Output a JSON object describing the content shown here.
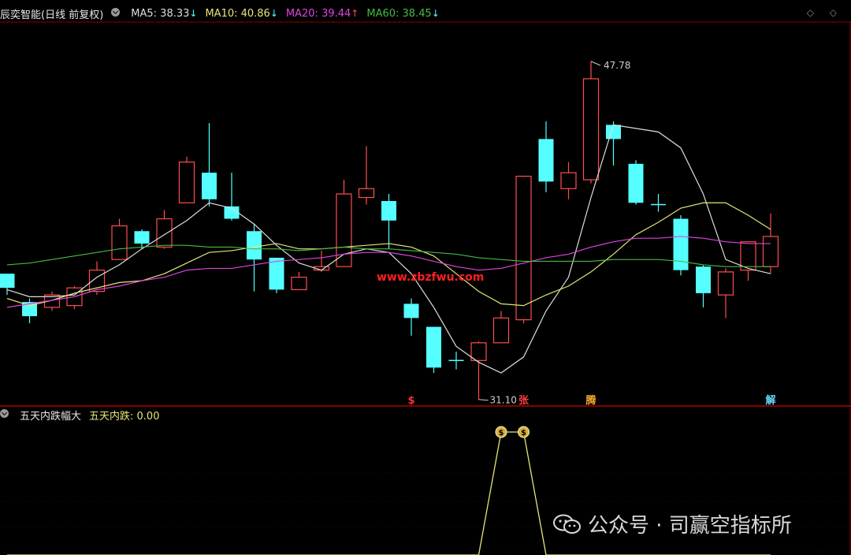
{
  "header": {
    "title": "辰奕智能(日线 前复权)",
    "ma5_label": "MA5: 38.33",
    "ma5_arrow": "↓",
    "ma10_label": "MA10: 40.86",
    "ma10_arrow": "↓",
    "ma20_label": "MA20: 39.44",
    "ma20_arrow": "↑",
    "ma60_label": "MA60: 38.45",
    "ma60_arrow": "↓",
    "top_icons": "◇ ◇"
  },
  "sub_header": {
    "title": "五天内跌幅大",
    "value_label": "五天内跌: 0.00"
  },
  "watermark": "www.zbzfwu.com",
  "credit": "公众号 · 司赢空指标所",
  "colors": {
    "up": "#ff4d4d",
    "down": "#55ffff",
    "ma5": "#dddddd",
    "ma10": "#e6e678",
    "ma20": "#dd44dd",
    "ma60": "#44bb44",
    "sub_line": "#e6e678"
  },
  "chart_data": {
    "type": "candlestick",
    "ylim": [
      29,
      50
    ],
    "annotations": {
      "high": "47.78",
      "low": "31.10"
    },
    "candles": [
      {
        "o": 35.8,
        "c": 35.0,
        "h": 35.8,
        "l": 34.6
      },
      {
        "o": 34.2,
        "c": 33.4,
        "h": 34.4,
        "l": 33.0
      },
      {
        "o": 33.9,
        "c": 34.6,
        "h": 34.8,
        "l": 33.7
      },
      {
        "o": 34.0,
        "c": 35.0,
        "h": 35.1,
        "l": 33.8
      },
      {
        "o": 34.8,
        "c": 36.0,
        "h": 36.5,
        "l": 34.6
      },
      {
        "o": 36.6,
        "c": 38.5,
        "h": 38.9,
        "l": 36.6
      },
      {
        "o": 38.2,
        "c": 37.5,
        "h": 38.3,
        "l": 37.2
      },
      {
        "o": 37.3,
        "c": 38.9,
        "h": 39.4,
        "l": 37.2
      },
      {
        "o": 39.8,
        "c": 42.1,
        "h": 42.4,
        "l": 39.8
      },
      {
        "o": 41.5,
        "c": 40.0,
        "h": 44.3,
        "l": 39.6
      },
      {
        "o": 39.6,
        "c": 38.9,
        "h": 41.5,
        "l": 38.8
      },
      {
        "o": 38.2,
        "c": 36.6,
        "h": 38.6,
        "l": 34.8
      },
      {
        "o": 36.7,
        "c": 34.9,
        "h": 36.7,
        "l": 34.7
      },
      {
        "o": 34.9,
        "c": 35.6,
        "h": 35.9,
        "l": 34.9
      },
      {
        "o": 36.0,
        "c": 36.2,
        "h": 37.1,
        "l": 35.9
      },
      {
        "o": 36.2,
        "c": 40.3,
        "h": 41.1,
        "l": 36.2
      },
      {
        "o": 40.1,
        "c": 40.6,
        "h": 43.0,
        "l": 39.7
      },
      {
        "o": 39.9,
        "c": 38.8,
        "h": 40.3,
        "l": 37.2
      },
      {
        "o": 34.1,
        "c": 33.3,
        "h": 34.4,
        "l": 32.3
      },
      {
        "o": 32.8,
        "c": 30.5,
        "h": 32.8,
        "l": 30.2
      },
      {
        "o": 30.9,
        "c": 30.9,
        "h": 31.4,
        "l": 30.4
      },
      {
        "o": 30.9,
        "c": 31.9,
        "h": 32.0,
        "l": 28.7
      },
      {
        "o": 31.9,
        "c": 33.3,
        "h": 33.7,
        "l": 31.9
      },
      {
        "o": 33.2,
        "c": 41.3,
        "h": 41.3,
        "l": 33.0
      },
      {
        "o": 43.4,
        "c": 41.0,
        "h": 44.4,
        "l": 40.4
      },
      {
        "o": 40.6,
        "c": 41.5,
        "h": 42.1,
        "l": 40.0
      },
      {
        "o": 41.1,
        "c": 46.8,
        "h": 47.78,
        "l": 40.9
      },
      {
        "o": 44.2,
        "c": 43.4,
        "h": 44.4,
        "l": 41.9
      },
      {
        "o": 42.0,
        "c": 39.8,
        "h": 42.2,
        "l": 39.7
      },
      {
        "o": 39.7,
        "c": 39.7,
        "h": 40.3,
        "l": 39.3
      },
      {
        "o": 38.9,
        "c": 36.0,
        "h": 39.1,
        "l": 35.7
      },
      {
        "o": 36.2,
        "c": 34.7,
        "h": 36.3,
        "l": 33.9
      },
      {
        "o": 34.6,
        "c": 35.9,
        "h": 36.1,
        "l": 33.3
      },
      {
        "o": 36.0,
        "c": 37.6,
        "h": 37.6,
        "l": 35.4
      },
      {
        "o": 36.2,
        "c": 37.9,
        "h": 39.2,
        "l": 35.8
      }
    ],
    "series": [
      {
        "values": [
          34.9,
          34.5,
          34.5,
          34.6,
          35.6,
          36.3,
          37.2,
          38.0,
          38.8,
          39.8,
          39.5,
          38.6,
          37.4,
          36.4,
          36.0,
          36.9,
          37.2,
          37.0,
          35.8,
          33.9,
          31.7,
          30.8,
          30.2,
          31.1,
          33.7,
          35.6,
          40.1,
          44.2,
          44.0,
          43.8,
          42.9,
          40.3,
          36.6,
          36.1,
          35.8
        ]
      },
      {
        "values": [
          34.4,
          34.0,
          34.3,
          34.7,
          35.0,
          35.3,
          35.4,
          35.8,
          36.4,
          37.0,
          37.1,
          37.3,
          37.5,
          37.2,
          37.2,
          37.3,
          37.4,
          37.5,
          37.3,
          36.8,
          35.8,
          34.8,
          34.1,
          34.0,
          34.6,
          35.1,
          35.9,
          36.9,
          38.0,
          38.7,
          39.5,
          39.8,
          39.8,
          39.1,
          38.3
        ]
      },
      {
        "values": [
          33.9,
          34.1,
          34.3,
          34.5,
          34.9,
          35.1,
          35.4,
          35.6,
          36.0,
          36.1,
          36.1,
          36.3,
          36.5,
          36.6,
          36.7,
          36.9,
          37.0,
          37.0,
          36.8,
          36.5,
          36.2,
          36.0,
          36.1,
          36.4,
          36.7,
          36.9,
          37.3,
          37.6,
          37.8,
          37.8,
          37.9,
          37.8,
          37.6,
          37.5,
          37.5
        ]
      },
      {
        "values": [
          36.3,
          36.4,
          36.6,
          36.8,
          37.0,
          37.2,
          37.3,
          37.4,
          37.4,
          37.3,
          37.3,
          37.2,
          37.2,
          37.1,
          37.2,
          37.3,
          37.2,
          37.2,
          37.1,
          37.0,
          36.9,
          36.7,
          36.6,
          36.5,
          36.5,
          36.5,
          36.5,
          36.6,
          36.6,
          36.6,
          36.5,
          36.3,
          36.2,
          36.2,
          36.2
        ]
      }
    ],
    "signals": [
      {
        "index": 18,
        "label": "$",
        "color": "#ff3030"
      },
      {
        "index": 23,
        "label": "张",
        "color": "#ff4040"
      },
      {
        "index": 26,
        "label": "腾",
        "color": "#ffb030"
      },
      {
        "index": 34,
        "label": "解",
        "color": "#66ddff"
      }
    ],
    "sub_chart": {
      "values": [
        0,
        0,
        0,
        0,
        0,
        0,
        0,
        0,
        0,
        0,
        0,
        0,
        0,
        0,
        0,
        0,
        0,
        0,
        0,
        0,
        0,
        0,
        1,
        1,
        0,
        0,
        0,
        0,
        0,
        0,
        0,
        0,
        0,
        0,
        0
      ],
      "marker": "$"
    }
  }
}
